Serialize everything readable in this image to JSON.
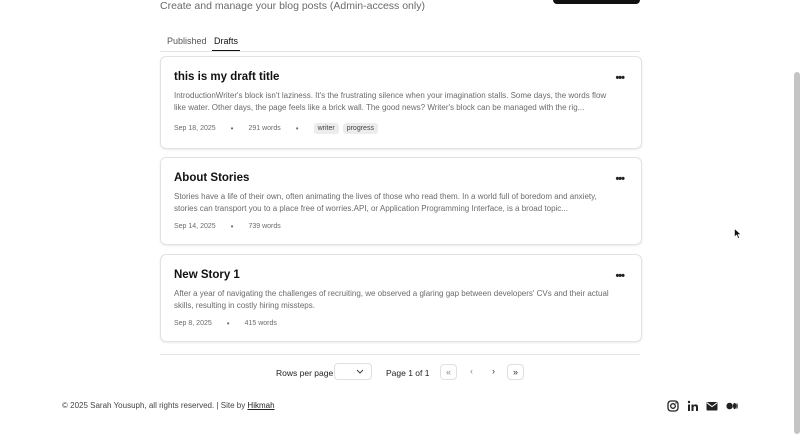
{
  "header": {
    "subtitle": "Create and manage your blog posts (Admin-access only)"
  },
  "tabs": [
    {
      "label": "Published",
      "active": false
    },
    {
      "label": "Drafts",
      "active": true
    }
  ],
  "posts": [
    {
      "title": "this is my draft title",
      "excerpt": "IntroductionWriter's block isn't laziness. It's the frustrating silence when your imagination stalls. Some days, the words flow like water. Other days, the page feels like a brick wall. The good news? Writer's block can be managed with the rig...",
      "date": "Sep 18, 2025",
      "words": "291 words",
      "tags": [
        "writer",
        "progress"
      ]
    },
    {
      "title": "About Stories",
      "excerpt": "Stories have a life of their own, often animating the lives of those who read them. In a world full of boredom and anxiety, stories can transport you to a place free of worries.API, or Application Programming Interface, is a broad topic...",
      "date": "Sep 14, 2025",
      "words": "739 words",
      "tags": []
    },
    {
      "title": "New Story 1",
      "excerpt": "After a year of navigating the challenges of recruiting, we observed a glaring gap between developers' CVs and their actual skills, resulting in costly hiring missteps.",
      "date": "Sep 8, 2025",
      "words": "415 words",
      "tags": []
    }
  ],
  "more_glyph": "•••",
  "separator": "•",
  "pagination": {
    "rows_label": "Rows per page",
    "rows_value": "",
    "page_info": "Page 1 of 1",
    "first": "«",
    "prev": "‹",
    "next": "›",
    "last": "»"
  },
  "footer": {
    "copyright": "© 2025 Sarah Yousuph, all rights reserved. | Site by ",
    "site_link": "Hikmah",
    "social": [
      "instagram-icon",
      "linkedin-icon",
      "mail-icon",
      "medium-icon"
    ]
  }
}
